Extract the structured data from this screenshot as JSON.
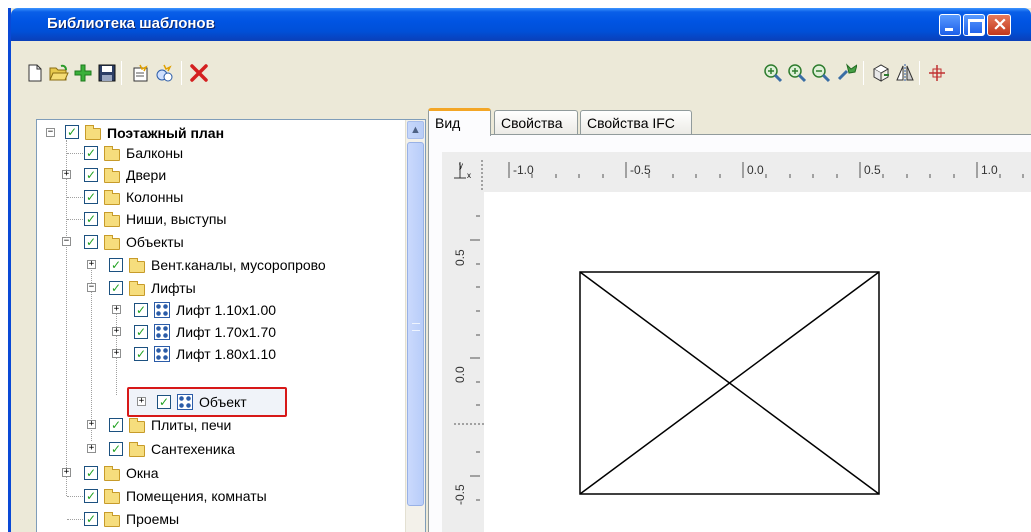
{
  "window": {
    "title": "Библиотека шаблонов"
  },
  "toolbar": {
    "left_icons": [
      "new-file-icon",
      "open-folder-icon",
      "add-plus-icon",
      "save-icon",
      "new-template-icon",
      "new-object-icon",
      "delete-icon"
    ],
    "right_icons": [
      "zoom-extents-icon",
      "zoom-in-icon",
      "zoom-out-icon",
      "pan-icon",
      "rotate-view-icon",
      "mirror-icon",
      "center-icon"
    ]
  },
  "tree": {
    "root": "Поэтажный план",
    "items": [
      {
        "label": "Балконы"
      },
      {
        "label": "Двери"
      },
      {
        "label": "Колонны"
      },
      {
        "label": "Ниши, выступы"
      },
      {
        "label": "Объекты"
      },
      {
        "label": "Вент.каналы, мусоропрово"
      },
      {
        "label": "Лифты"
      },
      {
        "label": "Лифт 1.10x1.00"
      },
      {
        "label": "Лифт 1.70x1.70"
      },
      {
        "label": "Лифт 1.80x1.10"
      },
      {
        "label": "Объект"
      },
      {
        "label": "Плиты, печи"
      },
      {
        "label": "Сантехеника"
      },
      {
        "label": "Окна"
      },
      {
        "label": "Помещения, комнаты"
      },
      {
        "label": "Проемы"
      }
    ]
  },
  "tabs": {
    "view": "Вид",
    "properties": "Свойства",
    "ifc": "Свойства IFC"
  },
  "preview": {
    "axis_corner": "y x",
    "h_ticks": [
      "-1.0",
      "-0.5",
      "0.0",
      "0.5",
      "1.0"
    ],
    "v_ticks": [
      "0.5",
      "0.0",
      "-0.5"
    ]
  },
  "colors": {
    "titlebar": "#0054e3",
    "highlight": "#d71818",
    "checkmark": "#21a121"
  }
}
